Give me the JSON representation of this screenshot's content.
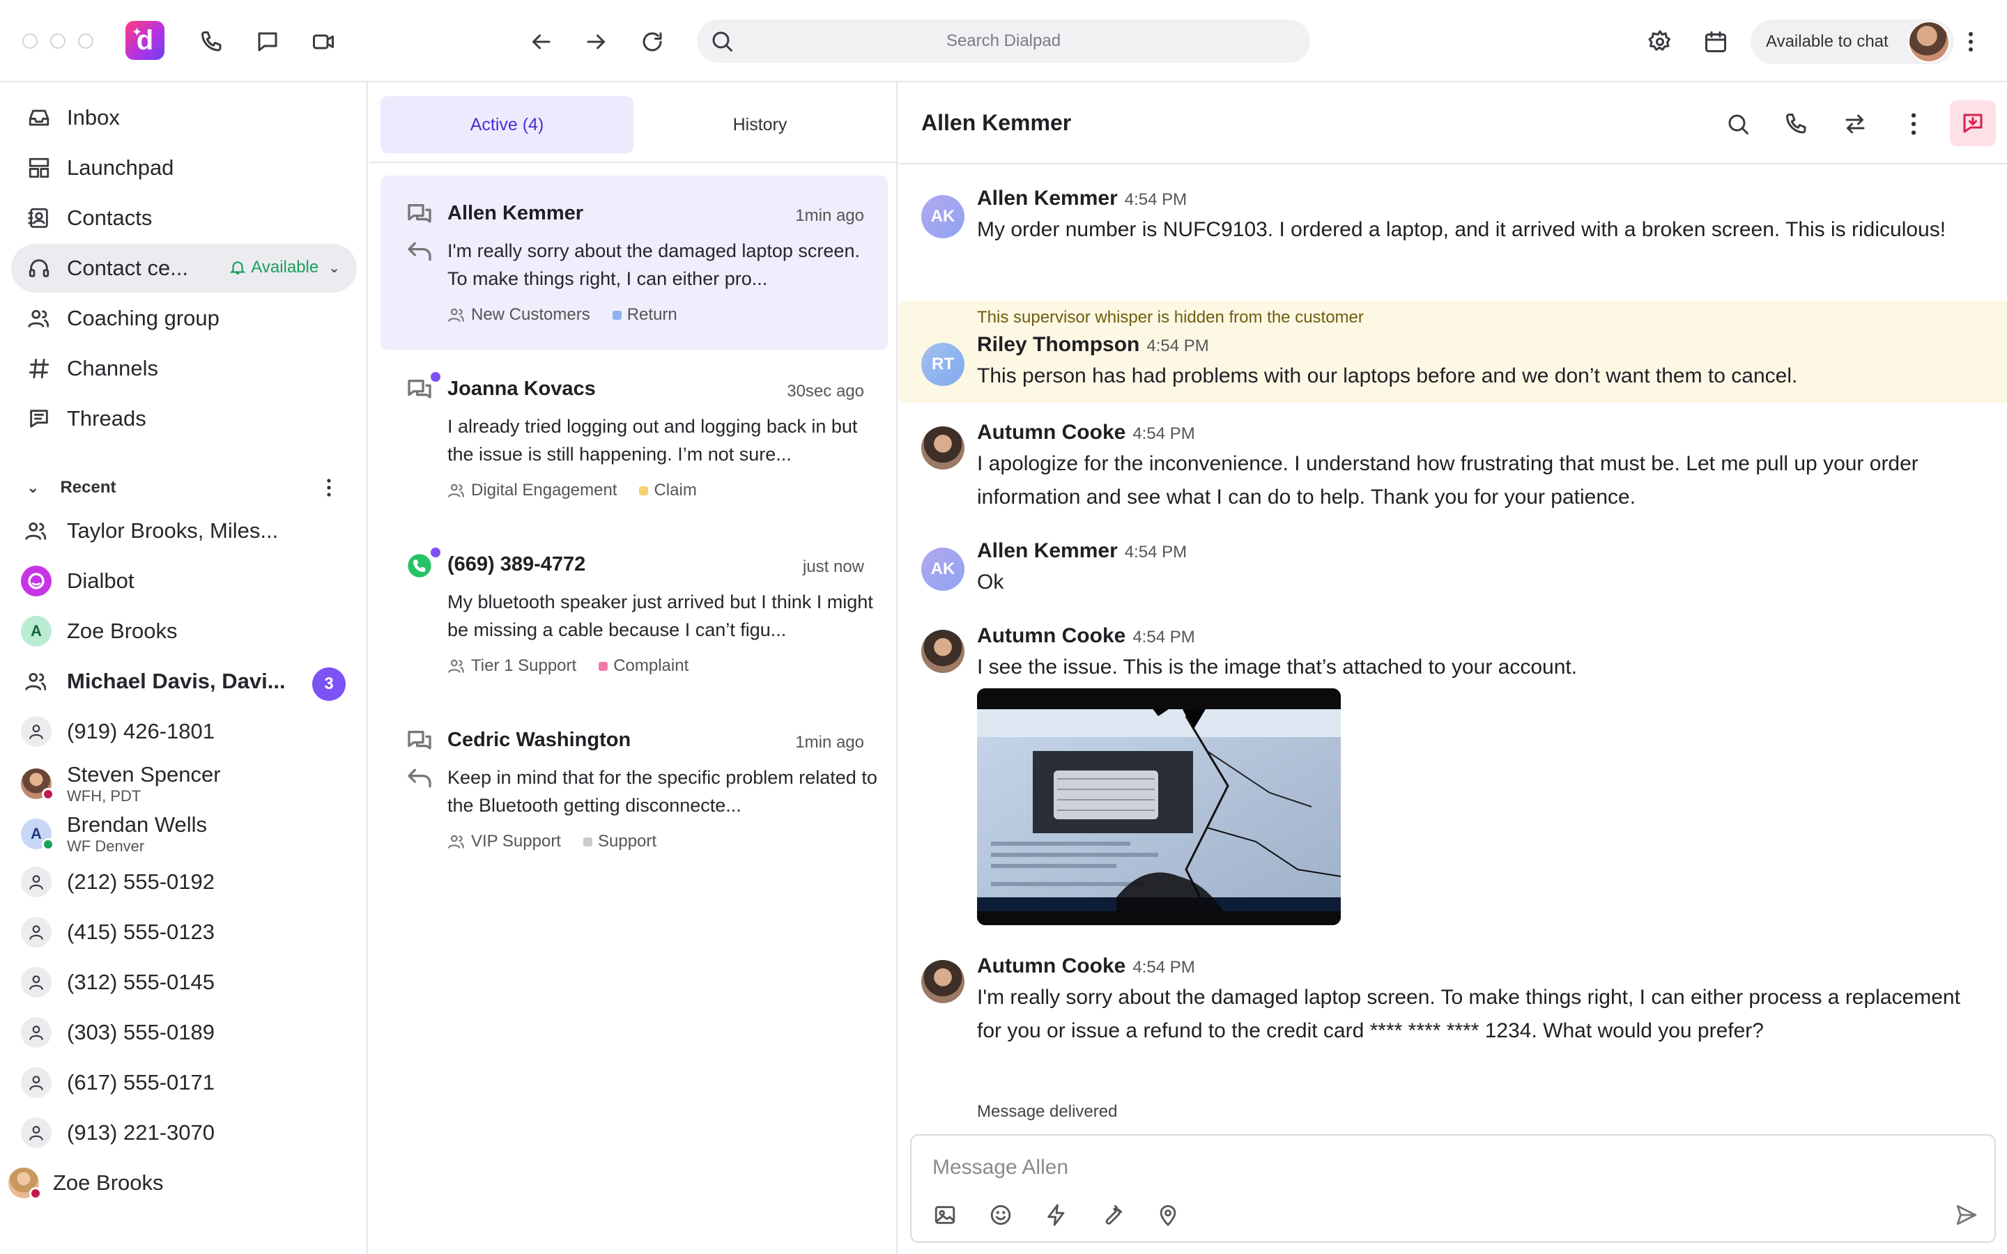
{
  "topbar": {
    "search_placeholder": "Search Dialpad",
    "status_label": "Available to chat",
    "logo_letter": "d"
  },
  "sidebar": {
    "nav": [
      {
        "label": "Inbox",
        "icon": "inbox-icon"
      },
      {
        "label": "Launchpad",
        "icon": "launchpad-icon"
      },
      {
        "label": "Contacts",
        "icon": "contacts-icon"
      },
      {
        "label": "Contact ce...",
        "icon": "headset-icon",
        "status": "Available"
      },
      {
        "label": "Coaching group",
        "icon": "group-icon"
      },
      {
        "label": "Channels",
        "icon": "hash-icon"
      },
      {
        "label": "Threads",
        "icon": "threads-icon"
      }
    ],
    "recent_label": "Recent",
    "recent": [
      {
        "label": "Taylor Brooks, Miles..."
      },
      {
        "label": "Dialbot"
      },
      {
        "label": "Zoe Brooks",
        "initial": "A"
      },
      {
        "label": "Michael Davis, Davi...",
        "badge": "3"
      },
      {
        "label": "(919) 426-1801"
      },
      {
        "label": "Steven Spencer",
        "sub": "WFH, PDT"
      },
      {
        "label": "Brendan Wells",
        "sub": "WF Denver",
        "initial": "A"
      },
      {
        "label": "(212) 555-0192"
      },
      {
        "label": "(415) 555-0123"
      },
      {
        "label": "(312) 555-0145"
      },
      {
        "label": "(303) 555-0189"
      },
      {
        "label": "(617) 555-0171"
      },
      {
        "label": "(913) 221-3070"
      },
      {
        "label": "Zoe Brooks"
      }
    ]
  },
  "convlist": {
    "tabs": [
      "Active (4)",
      "History"
    ],
    "items": [
      {
        "name": "Allen Kemmer",
        "time": "1min ago",
        "preview": "I'm really sorry about the damaged laptop screen. To make things right, I can either pro...",
        "group": "New Customers",
        "tag": "Return",
        "tag_color": "#8fb3f0"
      },
      {
        "name": "Joanna Kovacs",
        "time": "30sec ago",
        "preview": "I already tried logging out and logging back in but the issue is still happening. I’m not sure...",
        "group": "Digital Engagement",
        "tag": "Claim",
        "tag_color": "#f5d470"
      },
      {
        "name": "(669) 389-4772",
        "time": "just now",
        "preview": "My bluetooth speaker just arrived but I think I might be missing a cable because I can’t figu...",
        "group": "Tier 1 Support",
        "tag": "Complaint",
        "tag_color": "#f07aa8"
      },
      {
        "name": "Cedric Washington",
        "time": "1min ago",
        "preview": "Keep in mind that for the specific problem related to the Bluetooth getting disconnecte...",
        "group": "VIP Support",
        "tag": "Support",
        "tag_color": "#c9c9cf"
      }
    ]
  },
  "chat": {
    "title": "Allen Kemmer",
    "whisper_note": "This supervisor whisper is hidden from the customer",
    "messages": [
      {
        "initials": "AK",
        "name": "Allen Kemmer",
        "time": "4:54 PM",
        "text": "My order number is NUFC9103. I ordered a laptop, and it arrived with a broken screen. This is ridiculous!"
      },
      {
        "initials": "RT",
        "name": "Riley Thompson",
        "time": "4:54 PM",
        "text": "This person has had problems with our laptops before and we don’t want them to cancel."
      },
      {
        "name": "Autumn Cooke",
        "time": "4:54 PM",
        "text": "I apologize for the inconvenience. I understand how frustrating that must be. Let me pull up your order information and see what I can do to help. Thank you for your patience."
      },
      {
        "initials": "AK",
        "name": "Allen Kemmer",
        "time": "4:54 PM",
        "text": "Ok"
      },
      {
        "name": "Autumn Cooke",
        "time": "4:54 PM",
        "text": "I see the issue. This is the image that’s attached to your account."
      },
      {
        "name": "Autumn Cooke",
        "time": "4:54 PM",
        "text": "I'm really sorry about the damaged laptop screen. To make things right, I can either process a replacement for you or issue a refund to the credit card **** **** **** 1234. What would you prefer?"
      }
    ],
    "delivered": "Message delivered",
    "composer_placeholder": "Message Allen"
  },
  "colors": {
    "accent": "#7c52f5",
    "available": "#1a9f5c",
    "whisper_bg": "#fdf8e4",
    "active_tab_bg": "#eeeafd"
  }
}
